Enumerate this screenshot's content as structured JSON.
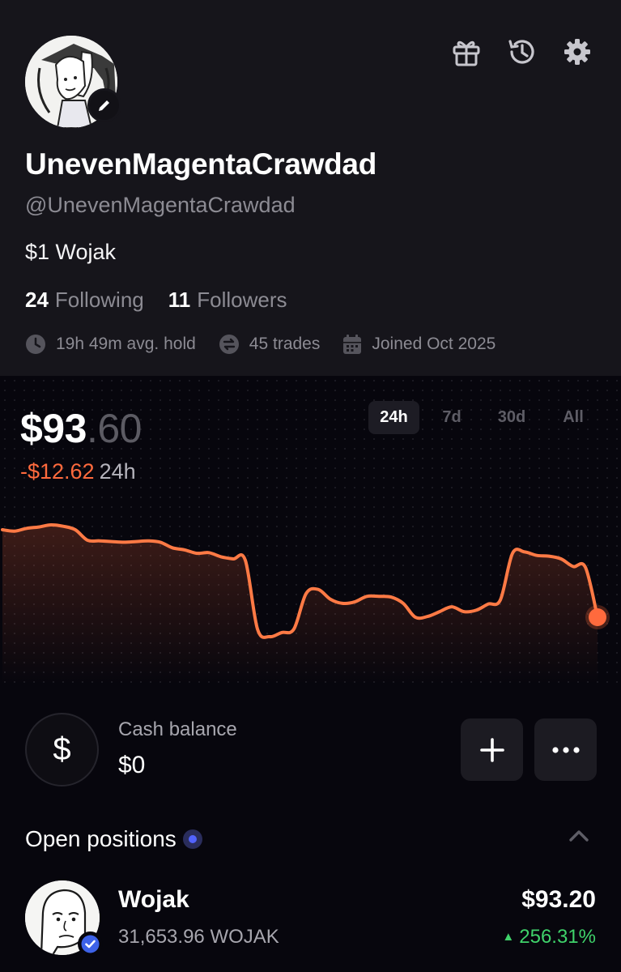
{
  "profile": {
    "display_name": "UnevenMagentaCrawdad",
    "handle": "@UnevenMagentaCrawdad",
    "bio": "$1 Wojak",
    "following_count": "24",
    "following_label": "Following",
    "followers_count": "11",
    "followers_label": "Followers",
    "avg_hold": "19h 49m avg. hold",
    "trades": "45 trades",
    "joined": "Joined Oct 2025"
  },
  "header_icons": [
    "gift-icon",
    "history-icon",
    "settings-icon"
  ],
  "portfolio": {
    "value_dollars": "$93",
    "value_cents": ".60",
    "change_amount": "-$12.62",
    "change_period": "24h",
    "range_tabs": [
      {
        "label": "24h",
        "active": true
      },
      {
        "label": "7d",
        "active": false
      },
      {
        "label": "30d",
        "active": false
      },
      {
        "label": "All",
        "active": false
      }
    ]
  },
  "chart_data": {
    "type": "area",
    "period": "24h",
    "values": [
      106.2,
      106.0,
      106.4,
      106.6,
      106.9,
      106.7,
      106.2,
      104.7,
      104.6,
      104.5,
      104.4,
      104.5,
      104.6,
      104.4,
      103.6,
      103.3,
      102.8,
      102.9,
      102.3,
      102.0,
      101.8,
      91.9,
      90.8,
      91.4,
      91.9,
      97.0,
      97.6,
      96.2,
      95.6,
      95.8,
      96.6,
      96.6,
      96.5,
      95.6,
      93.6,
      93.7,
      94.4,
      95.1,
      94.4,
      94.6,
      95.5,
      96.1,
      102.8,
      103.0,
      102.5,
      102.4,
      102.0,
      100.9,
      100.8,
      93.6
    ],
    "line_color": "#ff7a45",
    "grid": false
  },
  "cash": {
    "symbol": "$",
    "label": "Cash balance",
    "value": "$0"
  },
  "positions": {
    "title": "Open positions",
    "items": [
      {
        "name": "Wojak",
        "quantity": "31,653.96 WOJAK",
        "value": "$93.20",
        "change": "256.31%"
      }
    ]
  }
}
